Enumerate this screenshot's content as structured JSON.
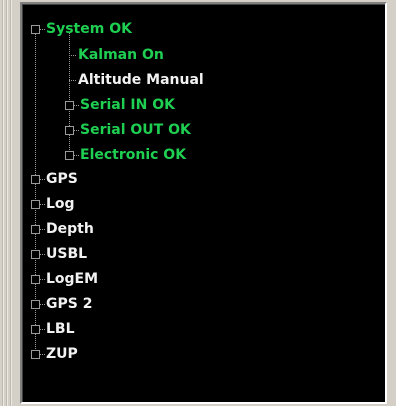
{
  "tree": {
    "root": {
      "label": "System OK"
    },
    "children": [
      {
        "label": "Kalman On"
      },
      {
        "label": "Altitude Manual"
      },
      {
        "label": "Serial IN OK"
      },
      {
        "label": "Serial OUT OK"
      },
      {
        "label": "Electronic OK"
      }
    ],
    "top_level": [
      {
        "label": "GPS"
      },
      {
        "label": "Log"
      },
      {
        "label": "Depth"
      },
      {
        "label": "USBL"
      },
      {
        "label": "LogEM"
      },
      {
        "label": "GPS 2"
      },
      {
        "label": "LBL"
      },
      {
        "label": "ZUP"
      }
    ]
  },
  "colors": {
    "ok_text": "#1fcf52",
    "normal_text": "#f2f2f2",
    "panel_background": "#000000"
  }
}
